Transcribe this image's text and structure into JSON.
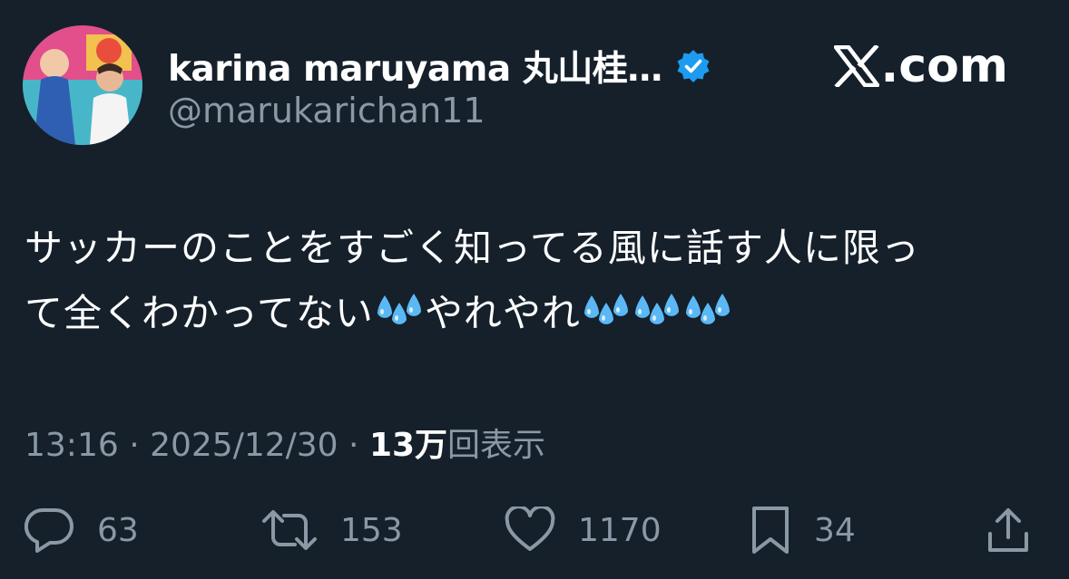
{
  "user": {
    "display_name": "karina maruyama 丸山桂…",
    "handle": "@marukarichan11",
    "verified": true,
    "avatar": "profile-photo"
  },
  "brand": {
    "logo_text": ".com"
  },
  "tweet": {
    "line1": "サッカーのことをすごく知ってる風に話す人に限っ",
    "line2_part1": "て全くわかってない",
    "line2_part2": "やれやれ",
    "emoji": "sweat-droplets"
  },
  "meta": {
    "time": "13:16",
    "sep1": " · ",
    "date": "2025/12/30",
    "sep2": " · ",
    "views_count": "13万",
    "views_label": "回表示"
  },
  "actions": {
    "replies": "63",
    "retweets": "153",
    "likes": "1170",
    "bookmarks": "34"
  },
  "colors": {
    "background": "#15202b",
    "text": "#ffffff",
    "secondary": "#8b98a5",
    "verified": "#1d9bf0",
    "emoji": "#5bb8f5"
  }
}
